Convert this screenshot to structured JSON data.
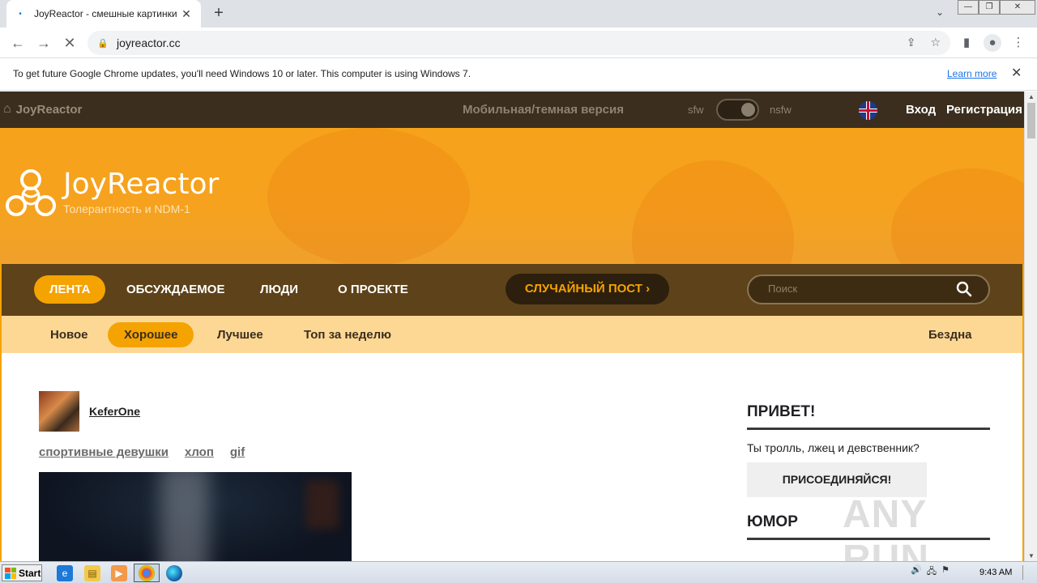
{
  "browser": {
    "tab_title": "JoyReactor - смешные картинки и",
    "tab_close": "✕",
    "new_tab": "+",
    "url": "joyreactor.cc",
    "win_min": "—",
    "win_restore": "❐",
    "win_close": "✕"
  },
  "infobar": {
    "message": "To get future Google Chrome updates, you'll need Windows 10 or later. This computer is using Windows 7.",
    "learn_more": "Learn more",
    "close": "✕"
  },
  "topbar": {
    "home_label": "JoyReactor",
    "mobile_label": "Мобильная/темная версия",
    "sfw_label": "sfw",
    "nsfw_label": "nsfw",
    "login": "Вход",
    "register": "Регистрация"
  },
  "banner": {
    "logo_name": "JoyReactor",
    "tagline": "Толерантность и NDM-1"
  },
  "main_nav": {
    "items": [
      "ЛЕНТА",
      "ОБСУЖДАЕМОЕ",
      "ЛЮДИ",
      "О ПРОЕКТЕ"
    ],
    "active": "ЛЕНТА",
    "random_post": "СЛУЧАЙНЫЙ ПОСТ",
    "search_placeholder": "Поиск"
  },
  "sub_nav": {
    "items": [
      "Новое",
      "Хорошее",
      "Лучшее",
      "Топ за неделю"
    ],
    "active": "Хорошее",
    "abyss": "Бездна"
  },
  "post": {
    "author": "KeferOne",
    "tags": [
      "спортивные девушки",
      "хлоп",
      "gif"
    ]
  },
  "sidebar": {
    "greeting_title": "ПРИВЕТ!",
    "greeting_text": "Ты тролль, лжец и девственник?",
    "join_button": "ПРИСОЕДИНЯЙСЯ!",
    "humor_title": "ЮМОР"
  },
  "watermark": "ANY RUN",
  "taskbar": {
    "start": "Start",
    "clock": "9:43 AM"
  },
  "colors": {
    "topbar_bg": "#3b2e1e",
    "banner_orange": "#f7a21b",
    "nav_brown": "#5e4219",
    "accent": "#f5a300",
    "subnav_bg": "#fdd895"
  }
}
